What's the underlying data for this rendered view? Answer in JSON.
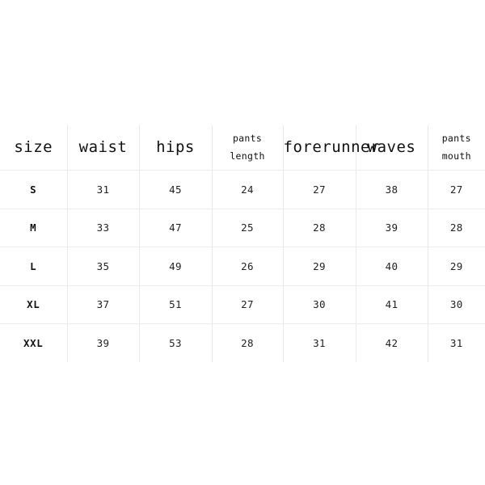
{
  "table": {
    "columns": [
      {
        "id": "size",
        "label": "size",
        "lines": [
          "size"
        ],
        "multiline": false
      },
      {
        "id": "waist",
        "label": "waist",
        "lines": [
          "waist"
        ],
        "multiline": false
      },
      {
        "id": "hips",
        "label": "hips",
        "lines": [
          "hips"
        ],
        "multiline": false
      },
      {
        "id": "pants_length",
        "label": "pants length",
        "lines": [
          "pants",
          "length"
        ],
        "multiline": true
      },
      {
        "id": "forerunner",
        "label": "forerunner",
        "lines": [
          "forerunner"
        ],
        "multiline": false
      },
      {
        "id": "waves",
        "label": "waves",
        "lines": [
          "waves"
        ],
        "multiline": false
      },
      {
        "id": "pants_mouth",
        "label": "pants mouth",
        "lines": [
          "pants",
          "mouth"
        ],
        "multiline": true
      }
    ],
    "rows": [
      {
        "size": "S",
        "waist": "31",
        "hips": "45",
        "pants_length": "24",
        "forerunner": "27",
        "waves": "38",
        "pants_mouth": "27"
      },
      {
        "size": "M",
        "waist": "33",
        "hips": "47",
        "pants_length": "25",
        "forerunner": "28",
        "waves": "39",
        "pants_mouth": "28"
      },
      {
        "size": "L",
        "waist": "35",
        "hips": "49",
        "pants_length": "26",
        "forerunner": "29",
        "waves": "40",
        "pants_mouth": "29"
      },
      {
        "size": "XL",
        "waist": "37",
        "hips": "51",
        "pants_length": "27",
        "forerunner": "30",
        "waves": "41",
        "pants_mouth": "30"
      },
      {
        "size": "XXL",
        "waist": "39",
        "hips": "53",
        "pants_length": "28",
        "forerunner": "31",
        "waves": "42",
        "pants_mouth": "31"
      }
    ]
  },
  "colors": {
    "background": "#ffffff",
    "grid_line": "#e9e9e9",
    "header_text": "#111111",
    "cell_text": "#222222"
  }
}
